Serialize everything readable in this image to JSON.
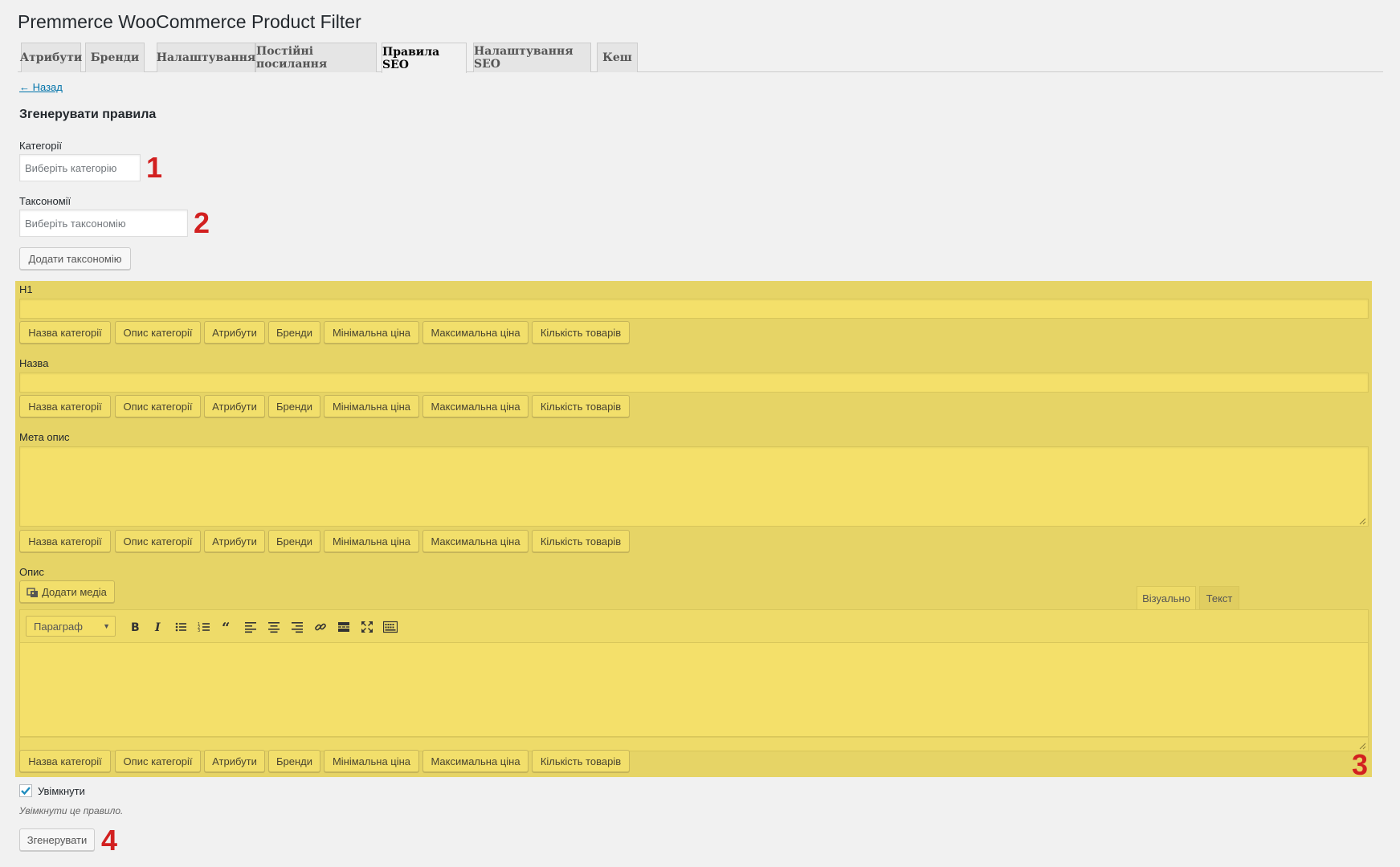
{
  "app_title": "Premmerce WooCommerce Product Filter",
  "tabs": [
    {
      "label": "Атрибути",
      "active": false
    },
    {
      "label": "Бренди",
      "active": false
    },
    {
      "label": "Налаштування",
      "active": false
    },
    {
      "label": "Постійні посилання",
      "active": false
    },
    {
      "label": "Правила SEO",
      "active": true
    },
    {
      "label": "Налаштування SEO",
      "active": false
    },
    {
      "label": "Кеш",
      "active": false
    }
  ],
  "back_link": "← Назад",
  "section_title": "Згенерувати правила",
  "categories": {
    "label": "Категорії",
    "placeholder": "Виберіть категорію",
    "annotation": "1"
  },
  "taxonomies": {
    "label": "Таксономії",
    "placeholder": "Виберіть таксономію",
    "annotation": "2"
  },
  "add_taxonomy_button": "Додати таксономію",
  "seo_fields": {
    "highlight_color": "#e6d466",
    "annotation": "3",
    "h1_label": "H1",
    "name_label": "Назва",
    "meta_label": "Мета опис",
    "description_label": "Опис",
    "tags": [
      "Назва категорії",
      "Опис категорії",
      "Атрибути",
      "Бренди",
      "Мінімальна ціна",
      "Максимальна ціна",
      "Кількість товарів"
    ]
  },
  "editor": {
    "add_media": "Додати медіа",
    "tab_visual": "Візуально",
    "tab_text": "Текст",
    "format": "Параграф",
    "toolbar_icons": [
      "bold-icon",
      "italic-icon",
      "bulleted-list-icon",
      "numbered-list-icon",
      "blockquote-icon",
      "align-left-icon",
      "align-center-icon",
      "align-right-icon",
      "link-icon",
      "read-more-icon",
      "fullscreen-icon",
      "toolbar-toggle-icon"
    ]
  },
  "enable": {
    "label": "Увімкнути",
    "description": "Увімкнути це правило.",
    "checked": true
  },
  "generate_button": "Згенерувати",
  "generate_annotation": "4"
}
